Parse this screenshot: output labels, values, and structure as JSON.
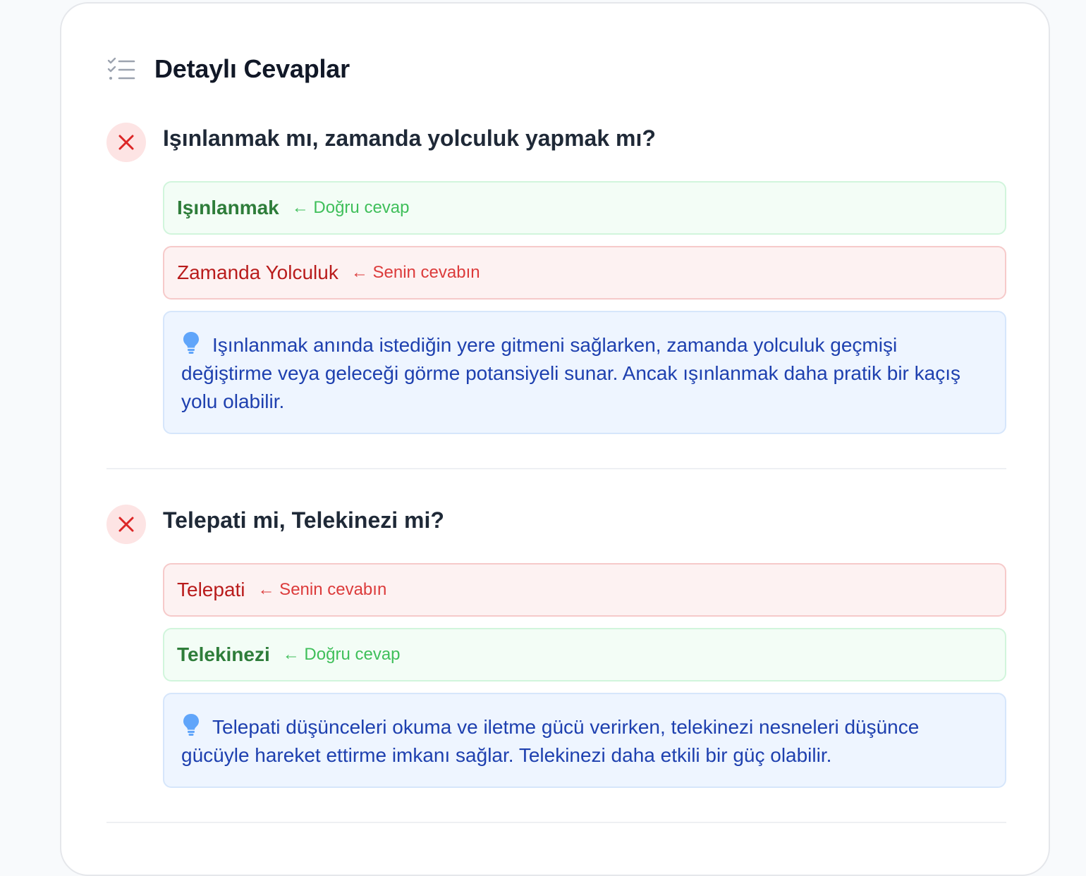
{
  "section": {
    "title": "Detaylı Cevaplar",
    "icon": "checklist-icon"
  },
  "questions": [
    {
      "status": "wrong",
      "title": "Işınlanmak mı, zamanda yolculuk yapmak mı?",
      "options": [
        {
          "label": "Işınlanmak",
          "tag": "← Doğru cevap",
          "kind": "correct"
        },
        {
          "label": "Zamanda Yolculuk",
          "tag": "← Senin cevabın",
          "kind": "wrong"
        }
      ],
      "explanation": "Işınlanmak anında istediğin yere gitmeni sağlarken, zamanda yolculuk geçmişi değiştirme veya geleceği görme potansiyeli sunar. Ancak ışınlanmak daha pratik bir kaçış yolu olabilir."
    },
    {
      "status": "wrong",
      "title": "Telepati mi, Telekinezi mi?",
      "options": [
        {
          "label": "Telepati",
          "tag": "← Senin cevabın",
          "kind": "wrong"
        },
        {
          "label": "Telekinezi",
          "tag": "← Doğru cevap",
          "kind": "correct"
        }
      ],
      "explanation": "Telepati düşünceleri okuma ve iletme gücü verirken, telekinezi nesneleri düşünce gücüyle hareket ettirme imkanı sağlar. Telekinezi daha etkili bir güç olabilir."
    }
  ],
  "colors": {
    "correct_text": "#2e7d3a",
    "wrong_text": "#b91c1c",
    "info_text": "#1e40af",
    "x_icon": "#dc2626"
  }
}
